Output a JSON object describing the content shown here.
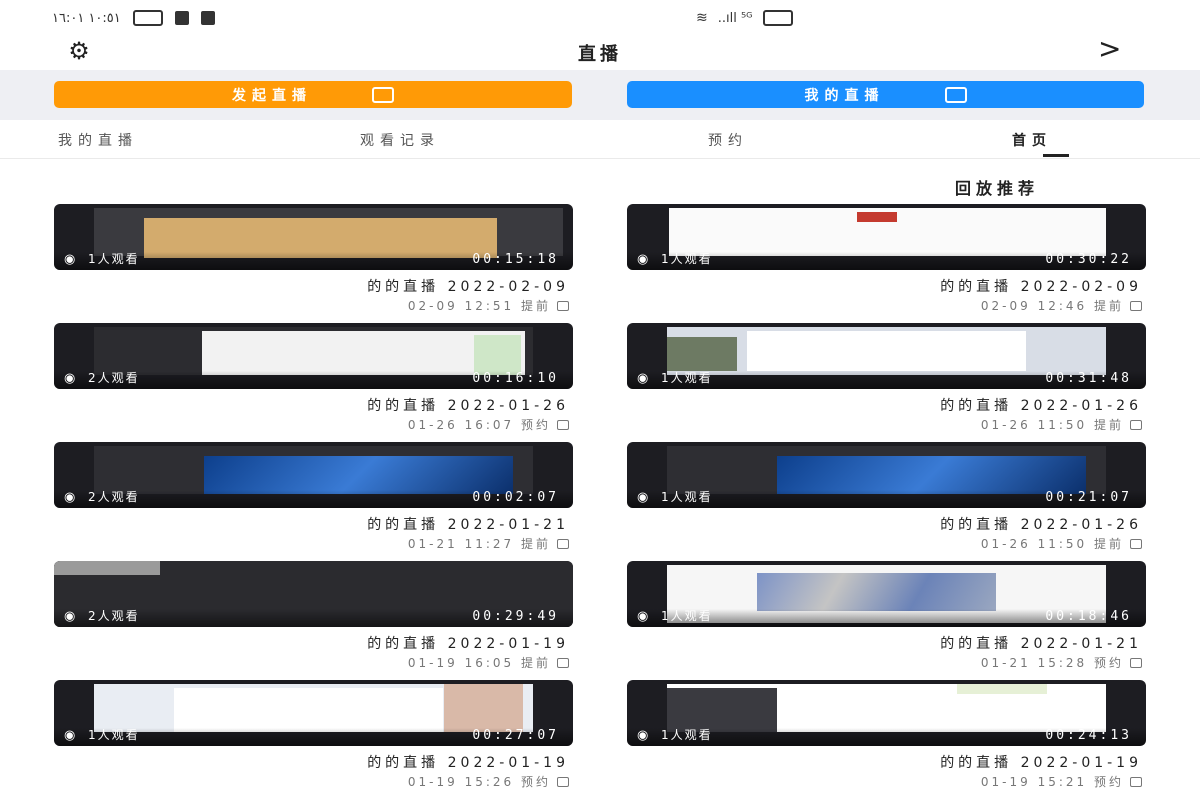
{
  "status_bar": {
    "left_text": "١٠:٥١ ١٦:٠١",
    "right_text": "..ıll ⁵ᴳ"
  },
  "header": {
    "title": "直播",
    "back_glyph": ">",
    "settings_glyph": "⚙"
  },
  "actions": {
    "orange_label": "发起直播",
    "blue_label": "我的直播"
  },
  "tabs": [
    {
      "label": "我的直播",
      "active": false
    },
    {
      "label": "观看记录",
      "active": false
    },
    {
      "label": "预约",
      "active": false
    },
    {
      "label": "首页",
      "active": true
    }
  ],
  "section_title": "回放推荐",
  "cards": [
    {
      "title": "的的直播 2022-02-09",
      "meta": "02-09 12:51 提前",
      "views": "1人观看",
      "duration": "00:15:18",
      "theme": "beige"
    },
    {
      "title": "的的直播 2022-02-09",
      "meta": "02-09 12:46 提前",
      "views": "1人观看",
      "duration": "00:30:22",
      "theme": "slide"
    },
    {
      "title": "的的直播 2022-01-26",
      "meta": "01-26 16:07 预约",
      "views": "2人观看",
      "duration": "00:16:10",
      "theme": "doc"
    },
    {
      "title": "的的直播 2022-01-26",
      "meta": "01-26 11:50 提前",
      "views": "1人观看",
      "duration": "00:31:48",
      "theme": "desktop"
    },
    {
      "title": "的的直播 2022-01-21",
      "meta": "01-21 11:27 提前",
      "views": "2人观看",
      "duration": "00:02:07",
      "theme": "blue"
    },
    {
      "title": "的的直播 2022-01-26",
      "meta": "01-26 11:50 提前",
      "views": "1人观看",
      "duration": "00:21:07",
      "theme": "blue"
    },
    {
      "title": "的的直播 2022-01-19",
      "meta": "01-19 16:05 提前",
      "views": "2人观看",
      "duration": "00:29:49",
      "theme": "dark"
    },
    {
      "title": "的的直播 2022-01-21",
      "meta": "01-21 15:28 预约",
      "views": "1人观看",
      "duration": "00:18:46",
      "theme": "bike"
    },
    {
      "title": "的的直播 2022-01-19",
      "meta": "01-19 15:26 预约",
      "views": "1人观看",
      "duration": "00:27:07",
      "theme": "browser"
    },
    {
      "title": "的的直播 2022-01-19",
      "meta": "01-19 15:21 预约",
      "views": "1人观看",
      "duration": "00:24:13",
      "theme": "table"
    }
  ],
  "colors": {
    "orange": "#ff9a06",
    "blue": "#1a8fff",
    "band": "#eeeff3"
  }
}
